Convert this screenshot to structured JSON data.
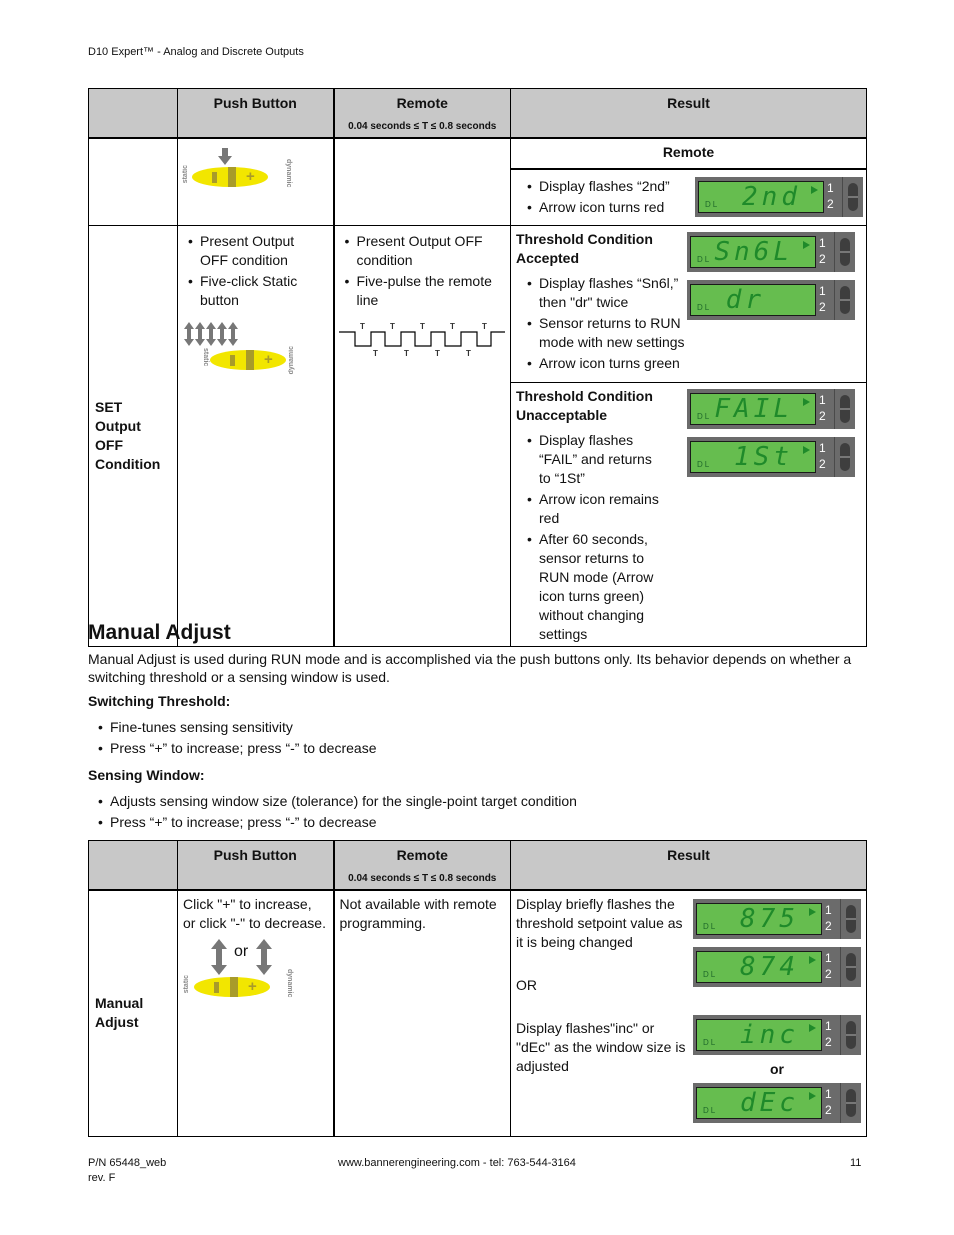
{
  "header": {
    "running_title": "D10 Expert™ - Analog and Discrete Outputs"
  },
  "table1": {
    "columns": {
      "push_button": "Push Button",
      "remote": "Remote",
      "remote_sub": "0.04 seconds ≤ T ≤ 0.8 seconds",
      "result": "Result"
    },
    "row1": {
      "result_subheader": "Remote",
      "result_bullets": [
        "Display flashes “2nd”",
        "Arrow icon turns red"
      ],
      "display": {
        "text": "2nd",
        "label": "DL",
        "num1": "1",
        "num2": "2"
      }
    },
    "row2": {
      "label": "SET Output OFF Condition",
      "push_bullets": [
        "Present Output OFF condition",
        "Five-click Static button"
      ],
      "remote_bullets": [
        "Present Output OFF condition",
        "Five-pulse the remote line"
      ],
      "pulse_label": "T",
      "button_labels": {
        "static": "static",
        "dynamic": "dynamic"
      },
      "accepted": {
        "title": "Threshold Condition Accepted",
        "bullets": [
          "Display flashes “Sn6l,” then \"dr\" twice",
          "Sensor returns to RUN mode with new settings",
          "Arrow icon turns green"
        ],
        "displays": [
          {
            "text": "Sn6L",
            "label": "DL",
            "num1": "1",
            "num2": "2",
            "arrow": true
          },
          {
            "text": "dr",
            "label": "DL",
            "num1": "1",
            "num2": "2",
            "arrow": false
          }
        ]
      },
      "unacceptable": {
        "title": "Threshold Condition Unacceptable",
        "bullets": [
          "Display flashes “FAIL” and returns to “1St”",
          "Arrow icon remains red",
          "After 60 seconds, sensor returns to RUN mode (Arrow icon turns green) without changing settings"
        ],
        "displays": [
          {
            "text": "FAIL",
            "label": "DL",
            "num1": "1",
            "num2": "2",
            "arrow": true
          },
          {
            "text": "1St",
            "label": "DL",
            "num1": "1",
            "num2": "2",
            "arrow": true
          }
        ]
      }
    }
  },
  "manual_adjust": {
    "heading": "Manual Adjust",
    "intro": "Manual Adjust is used during RUN mode and is accomplished via the push buttons only. Its behavior depends on whether a switching threshold or a sensing window is used.",
    "switching_heading": "Switching Threshold:",
    "switching_bullets": [
      "Fine-tunes sensing sensitivity",
      "Press “+” to increase; press “-” to decrease"
    ],
    "window_heading": "Sensing Window:",
    "window_bullets": [
      "Adjusts sensing window size (tolerance) for the single-point target condition",
      "Press “+” to increase; press “-” to decrease"
    ]
  },
  "table2": {
    "columns": {
      "push_button": "Push Button",
      "remote": "Remote",
      "remote_sub": "0.04 seconds ≤ T ≤ 0.8 seconds",
      "result": "Result"
    },
    "row": {
      "label": "Manual Adjust",
      "push_text": "Click \"+\" to increase, or click \"-\" to decrease.",
      "or_text": "or",
      "remote_text": "Not available with remote programming.",
      "result_text1": "Display briefly flashes the threshold setpoint value as it is being changed",
      "result_or": "OR",
      "result_text2": "Display flashes\"inc\" or \"dEc\" as the window size is adjusted",
      "display_or": "or",
      "displays": [
        {
          "text": "875",
          "label": "DL",
          "num1": "1",
          "num2": "2"
        },
        {
          "text": "874",
          "label": "DL",
          "num1": "1",
          "num2": "2"
        },
        {
          "text": "inc",
          "label": "DL",
          "num1": "1",
          "num2": "2"
        },
        {
          "text": "dEc",
          "label": "DL",
          "num1": "1",
          "num2": "2"
        }
      ]
    }
  },
  "footer": {
    "part_number": "P/N 65448_web",
    "revision": "rev. F",
    "contact": "www.bannerengineering.com - tel: 763-544-3164",
    "page_number": "11"
  },
  "colors": {
    "lcd_green": "#66bd4f",
    "lcd_body": "#6b6b6b",
    "segment": "#1f8a2a",
    "button_yellow": "#f2e600",
    "header_gray": "#c8c8c8"
  }
}
